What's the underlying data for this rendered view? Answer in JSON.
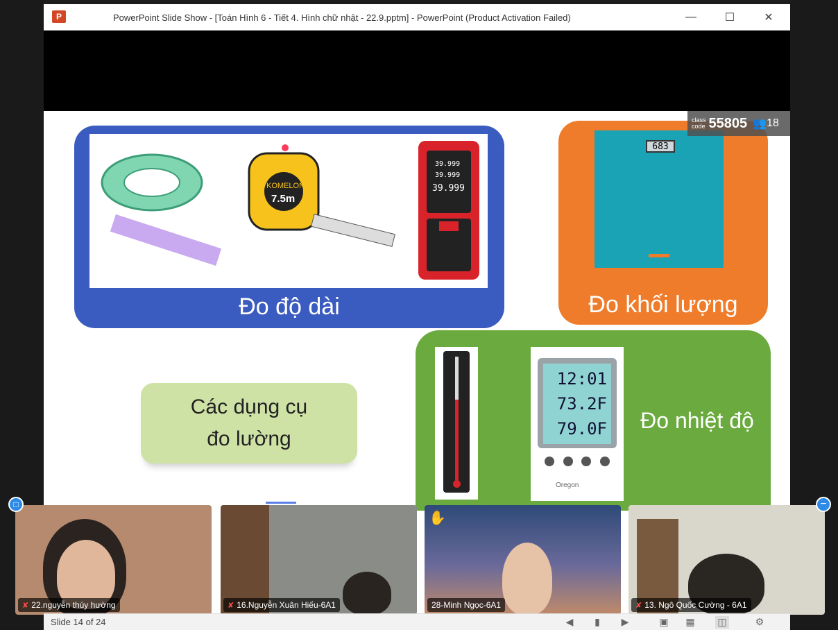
{
  "window": {
    "title": "PowerPoint Slide Show - [Toán Hình 6 - Tiết 4. Hình chữ nhật - 22.9.pptm] - PowerPoint (Product Activation Failed)",
    "app_icon_letter": "P",
    "minimize_glyph": "—",
    "maximize_glyph": "☐",
    "close_glyph": "✕"
  },
  "class_code": {
    "label_line1": "class",
    "label_line2": "code",
    "code": "55805",
    "participants_icon": "people-icon",
    "participants": "18"
  },
  "slide": {
    "length_label": "Đo độ dài",
    "mass_label": "Đo khối lượng",
    "temperature_label": "Đo nhiệt độ",
    "center_line1": "Các dụng cụ",
    "center_line2": "đo lường",
    "scale_reading": "683",
    "digital_time": "12:01",
    "digital_temp_in": "73.2F",
    "digital_temp_out": "79.0F",
    "digital_brand": "Oregon",
    "tape_brand": "KOMELON",
    "tape_size": "7.5m",
    "rangefinder_readings": [
      "39.999",
      "39.999",
      "39.999"
    ]
  },
  "participants": [
    {
      "name": "22.nguyễn thúy hường",
      "muted": true
    },
    {
      "name": "16.Nguyễn Xuân Hiếu-6A1",
      "muted": true
    },
    {
      "name": "28-Minh Ngọc-6A1",
      "muted": false,
      "hand_raised": true
    },
    {
      "name": "13. Ngô Quốc Cường - 6A1",
      "muted": true
    }
  ],
  "statusbar": {
    "slide_indicator": "Slide 14 of 24"
  },
  "colors": {
    "blue_panel": "#3a5bbf",
    "orange_panel": "#ef7c2a",
    "green_panel": "#6aaa3f",
    "label_box": "#cfe2a6",
    "accent": "#2d8ae6"
  }
}
